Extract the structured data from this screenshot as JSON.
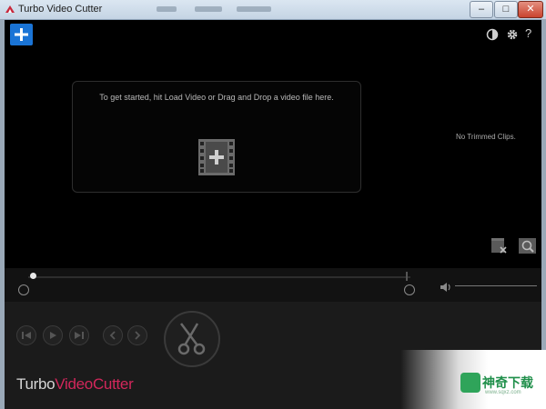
{
  "titlebar": {
    "title": "Turbo Video Cutter",
    "minimize_label": "–",
    "maximize_label": "□",
    "close_label": "✕"
  },
  "toolbar": {
    "add_icon": "plus-icon",
    "theme_icon": "contrast-icon",
    "settings_icon": "gear-icon",
    "help_label": "?"
  },
  "dropzone": {
    "hint": "To get started, hit Load Video or Drag and Drop a video file here.",
    "icon": "film-add-icon"
  },
  "clips_panel": {
    "empty_text": "No Trimmed Clips."
  },
  "colors": {
    "accent": "#1a74d6",
    "logo_pink": "#d2275b",
    "background": "#000000"
  },
  "logo": {
    "part1": "Turbo",
    "part2": "VideoCutter"
  },
  "watermark": {
    "text": "神奇下载",
    "url": "www.sqxz.com"
  }
}
